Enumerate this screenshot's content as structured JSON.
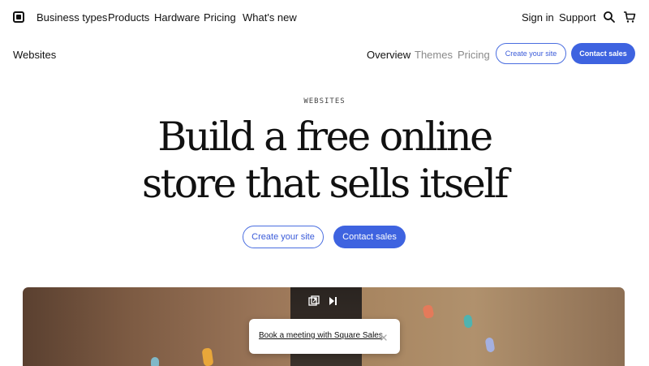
{
  "top_nav": {
    "logo_icon": "square-logo-icon",
    "links": [
      "Business types",
      "Products",
      "Hardware",
      "Pricing",
      "What's new"
    ],
    "sign_in": "Sign in",
    "support": "Support",
    "search_icon": "search-icon",
    "cart_icon": "cart-icon"
  },
  "sub_nav": {
    "title": "Websites",
    "links": [
      "Overview",
      "Themes",
      "Pricing"
    ],
    "active": "Overview",
    "create_label": "Create your site",
    "contact_label": "Contact sales"
  },
  "hero": {
    "eyebrow": "WEBSITES",
    "headline_line1": "Build a free online",
    "headline_line2": "store that sells itself",
    "create_label": "Create your site",
    "contact_label": "Contact sales"
  },
  "video": {
    "pip_icon": "picture-in-picture-icon",
    "play_icon": "play-pause-icon"
  },
  "toast": {
    "link_label": "Book a meeting with Square Sales",
    "close_icon": "close-icon"
  },
  "colors": {
    "accent": "#3e63e0",
    "text": "#111111",
    "muted": "#8a8a8a"
  }
}
